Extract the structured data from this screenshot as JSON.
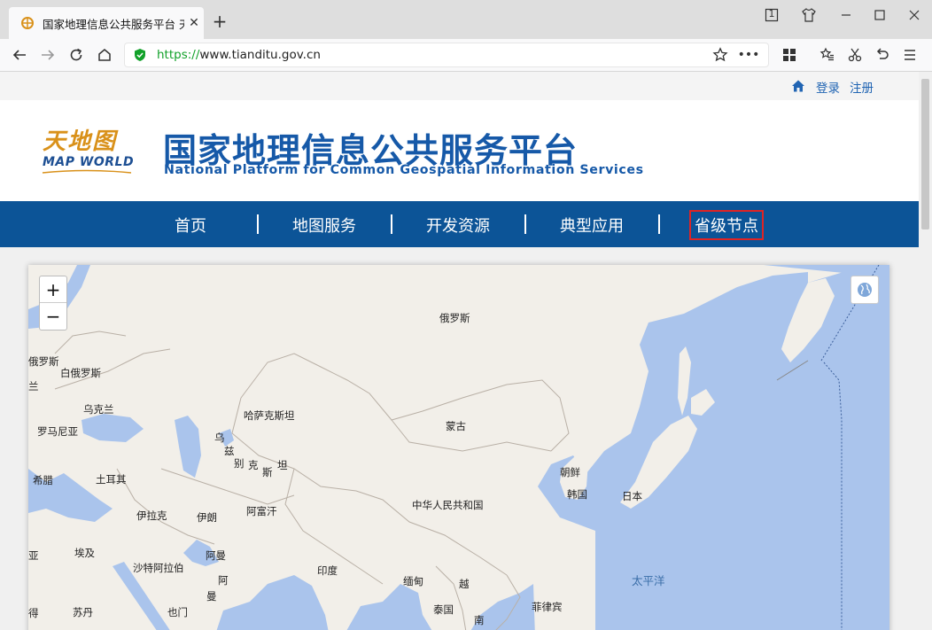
{
  "browser": {
    "tab_title": "国家地理信息公共服务平台 天",
    "url_scheme": "https://",
    "url_host": "www.tianditu.gov.cn",
    "tab_count_badge": "1",
    "accent_color": "#12a12a"
  },
  "userbar": {
    "login_label": "登录",
    "register_label": "注册"
  },
  "header": {
    "logo_cn": "天地图",
    "logo_en": "MAP WORLD",
    "title": "国家地理信息公共服务平台",
    "subtitle": "National Platform for Common Geospatial Information Services"
  },
  "nav": {
    "items": [
      {
        "label": "首页"
      },
      {
        "label": "地图服务"
      },
      {
        "label": "开发资源"
      },
      {
        "label": "典型应用"
      },
      {
        "label": "省级节点"
      }
    ],
    "active_index": 4,
    "bar_color": "#0c5497",
    "highlight_color": "#e02424"
  },
  "map": {
    "zoom_in": "+",
    "zoom_out": "−",
    "labels": {
      "russia": "俄罗斯",
      "russia_w": "俄罗斯",
      "belarus": "白俄罗斯",
      "ukraine": "乌克兰",
      "poland_fragment": "兰",
      "romania": "罗马尼亚",
      "kazakhstan": "哈萨克斯坦",
      "mongolia": "蒙古",
      "uz1": "乌",
      "uz2": "兹",
      "uz3": "别",
      "uz4": "克",
      "uz5": "斯",
      "uz6": "坦",
      "greece": "希腊",
      "turkey": "土耳其",
      "nkorea": "朝鲜",
      "skorea": "韩国",
      "japan": "日本",
      "china": "中华人民共和国",
      "iraq": "伊拉克",
      "iran": "伊朗",
      "afghanistan": "阿富汗",
      "egypt_fragment": "亚",
      "egypt": "埃及",
      "saudi": "沙特阿拉伯",
      "oman": "阿曼",
      "india": "印度",
      "myanmar": "缅甸",
      "vietnam": "越",
      "pacific": "太平洋",
      "uae1": "阿",
      "uae2": "曼",
      "sudan_fragment": "得",
      "sudan": "苏丹",
      "yemen": "也门",
      "thailand": "泰国",
      "cambodia": "南",
      "philippines": "菲律宾"
    }
  }
}
